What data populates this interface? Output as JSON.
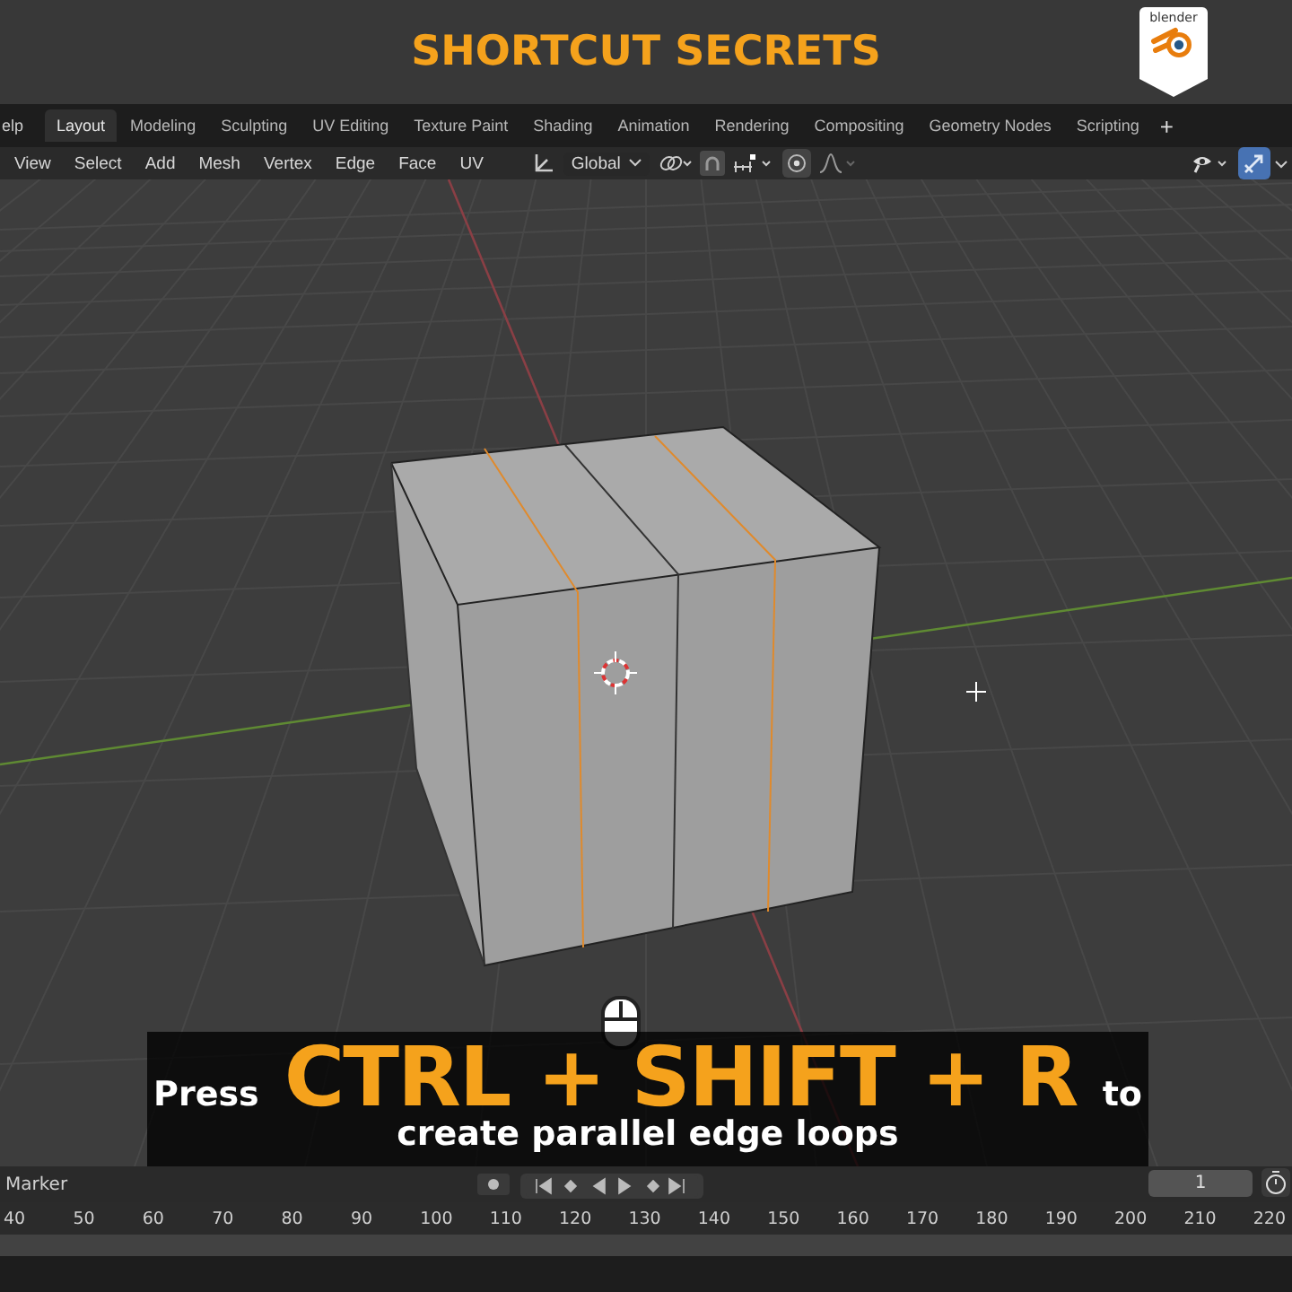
{
  "banner": {
    "title": "SHORTCUT SECRETS",
    "logo_text": "blender"
  },
  "topbar": {
    "menu_partial": "elp",
    "tabs": [
      {
        "label": "Layout",
        "selected": true
      },
      {
        "label": "Modeling",
        "selected": false
      },
      {
        "label": "Sculpting",
        "selected": false
      },
      {
        "label": "UV Editing",
        "selected": false
      },
      {
        "label": "Texture Paint",
        "selected": false
      },
      {
        "label": "Shading",
        "selected": false
      },
      {
        "label": "Animation",
        "selected": false
      },
      {
        "label": "Rendering",
        "selected": false
      },
      {
        "label": "Compositing",
        "selected": false
      },
      {
        "label": "Geometry Nodes",
        "selected": false
      },
      {
        "label": "Scripting",
        "selected": false
      }
    ],
    "add_tab": "+"
  },
  "header": {
    "menus": [
      "View",
      "Select",
      "Add",
      "Mesh",
      "Vertex",
      "Edge",
      "Face",
      "UV"
    ],
    "orientation": "Global",
    "proportional_editing": false,
    "gizmos_on": true
  },
  "caption": {
    "prefix": "Press",
    "shortcut": "CTRL + SHIFT + R",
    "suffix": "to",
    "line2": "create parallel edge loops"
  },
  "timeline": {
    "marker_label": "Marker",
    "current_frame": "1",
    "ruler": [
      "40",
      "50",
      "60",
      "70",
      "80",
      "90",
      "100",
      "110",
      "120",
      "130",
      "140",
      "150",
      "160",
      "170",
      "180",
      "190",
      "200",
      "210",
      "220"
    ]
  }
}
